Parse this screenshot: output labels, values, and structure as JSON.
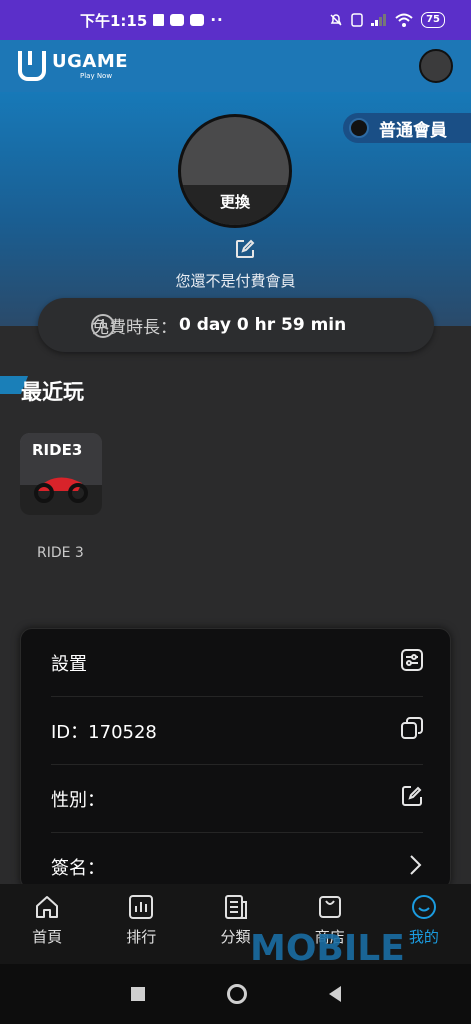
{
  "status_bar": {
    "time": "下午1:15",
    "dots": "··",
    "battery": "75"
  },
  "header": {
    "logo_name": "UGAME",
    "logo_tag": "Play Now"
  },
  "profile": {
    "member_badge": "普通會員",
    "change_label": "更換",
    "not_member_text": "您還不是付費會員",
    "free_time_label": "免費時長：",
    "free_time_value": "0 day 0 hr 59 min"
  },
  "recent": {
    "title": "最近玩",
    "games": [
      {
        "name": "RIDE 3",
        "thumb_text": "RIDE3"
      }
    ]
  },
  "settings": {
    "rows": [
      {
        "label": "設置",
        "icon": "settings-sliders-icon"
      },
      {
        "label": "ID：170528",
        "icon": "copy-icon"
      },
      {
        "label": "性別：",
        "icon": "edit-icon"
      },
      {
        "label": "簽名：",
        "icon": "chevron-right-icon"
      }
    ]
  },
  "bottom_nav": {
    "items": [
      {
        "label": "首頁",
        "icon": "home-icon"
      },
      {
        "label": "排行",
        "icon": "ranking-icon"
      },
      {
        "label": "分類",
        "icon": "category-icon"
      },
      {
        "label": "商店",
        "icon": "store-icon"
      },
      {
        "label": "我的",
        "icon": "profile-smile-icon",
        "active": true
      }
    ]
  },
  "watermark": "MOBILE",
  "colors": {
    "accent": "#1b9ce0",
    "header": "#1d77b6",
    "status_bar": "#5b2fc9"
  }
}
